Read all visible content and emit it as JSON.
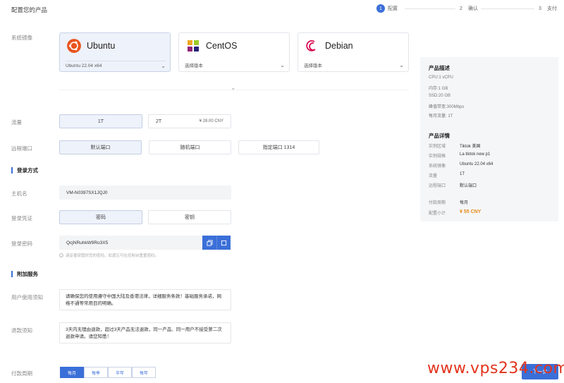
{
  "header": {
    "title": "配置您的产品",
    "steps": [
      {
        "num": "1",
        "label": "配置",
        "active": true
      },
      {
        "num": "2",
        "label": "确认",
        "active": false
      },
      {
        "num": "3",
        "label": "支付",
        "active": false
      }
    ]
  },
  "os": {
    "label": "系统镜像",
    "options": [
      {
        "name": "Ubuntu",
        "version": "Ubuntu 22.04 x64",
        "selected": true
      },
      {
        "name": "CentOS",
        "version": "选择版本",
        "selected": false
      },
      {
        "name": "Debian",
        "version": "选择版本",
        "selected": false
      }
    ],
    "divider_mark": "="
  },
  "traffic": {
    "label": "流量",
    "option1": "1T",
    "option2": "2T",
    "option2_price": "¥ 28.00 CNY"
  },
  "port": {
    "label": "远程端口",
    "options": [
      "默认端口",
      "随机端口",
      "指定端口 1314"
    ]
  },
  "login": {
    "section_title": "登录方式",
    "hostname_label": "主机名",
    "hostname_value": "VM-N0397SX1JQJ0",
    "verify_label": "登录凭证",
    "verify_options": [
      "密码",
      "密钥"
    ],
    "password_label": "登录密码",
    "password_value": "QcjNRuhkW9Ro3X5",
    "copy_icon": "copy-icon",
    "refresh_icon": "refresh-icon",
    "note": "请妥善保管好您的密码，如遗忘可在控制台重置密码。"
  },
  "extra": {
    "section_title": "附加服务",
    "agreement_label": "用户使用须知",
    "agreement_text": "请确保您的使用遵守中国大陆及香港法律，详细服务条款！基础服务承诺，网络不通等常用目的明确。",
    "refund_label": "退款须知",
    "refund_text": "3天内无理由退款，超过3天产品无法退款，同一产品、同一用户不接受第二次退款申请。请您知悉！"
  },
  "cycle": {
    "label": "付款周期",
    "options": [
      "每月",
      "每季",
      "半年",
      "每年"
    ]
  },
  "panel": {
    "desc_title": "产品描述",
    "desc_lines": [
      "CPU:1 vCPU",
      "内存:1 GB",
      "SSD:20 GB",
      "峰值带宽:300Mbps",
      "每月流量: 1T"
    ],
    "detail_title": "产品详情",
    "details": [
      {
        "k": "实例区域",
        "v": "Tiktok 美国"
      },
      {
        "k": "实例规格",
        "v": "La tiktok new p1"
      },
      {
        "k": "系统镜像",
        "v": "Ubuntu 22.04 x64"
      },
      {
        "k": "流量",
        "v": "1T"
      },
      {
        "k": "远程端口",
        "v": "默认端口"
      }
    ],
    "cycle_k": "付款周期",
    "cycle_v": "每月",
    "total_k": "配置小计",
    "total_v": "¥ 55 CNY"
  },
  "footer": {
    "watermark": "www.vps234.com",
    "next_button": "下一步"
  },
  "colors": {
    "accent": "#3b6fd8",
    "price": "#e48a1a",
    "watermark": "#e2331c"
  }
}
